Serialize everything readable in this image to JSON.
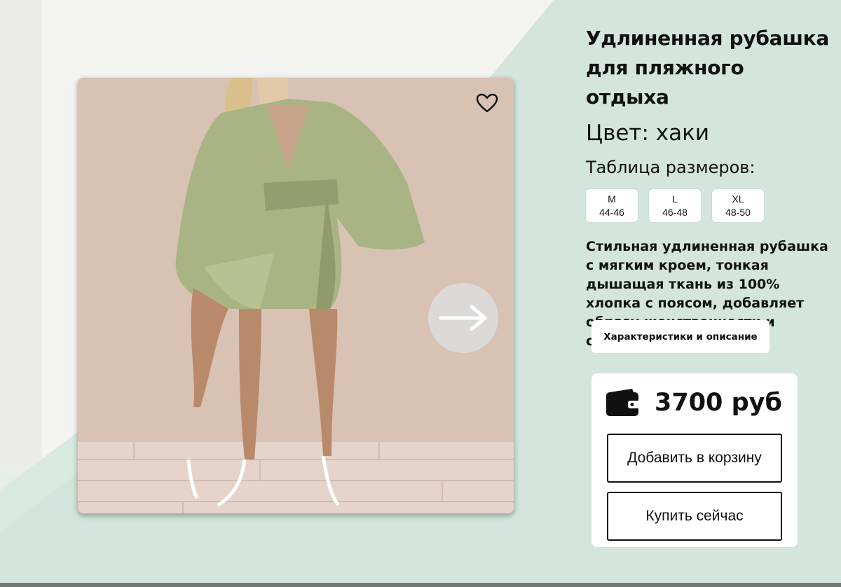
{
  "product": {
    "title_line1": "Удлиненная рубашка",
    "title_line2": "для пляжного отдыха",
    "color_label": "Цвет: хаки",
    "size_table_label": "Таблица размеров:",
    "sizes": [
      {
        "name": "M",
        "range": "44-46"
      },
      {
        "name": "L",
        "range": "46-48"
      },
      {
        "name": "XL",
        "range": "48-50"
      }
    ],
    "description": "Стильная удлиненная рубашка с мягким кроем, тонкая дышащая ткань из 100% хлопка с поясом, добавляет образу женственности и свободы движения",
    "specs_button": "Характеристики и описание",
    "price": "3700 руб",
    "add_to_cart": "Добавить в корзину",
    "buy_now": "Купить сейчас"
  },
  "icons": {
    "favorite": "heart-icon",
    "next": "arrow-right-icon",
    "wallet": "wallet-icon"
  },
  "colors": {
    "accent_mint": "#d3e5dc",
    "background_light": "#f2f2f0",
    "text": "#111111",
    "panel": "#ffffff"
  }
}
